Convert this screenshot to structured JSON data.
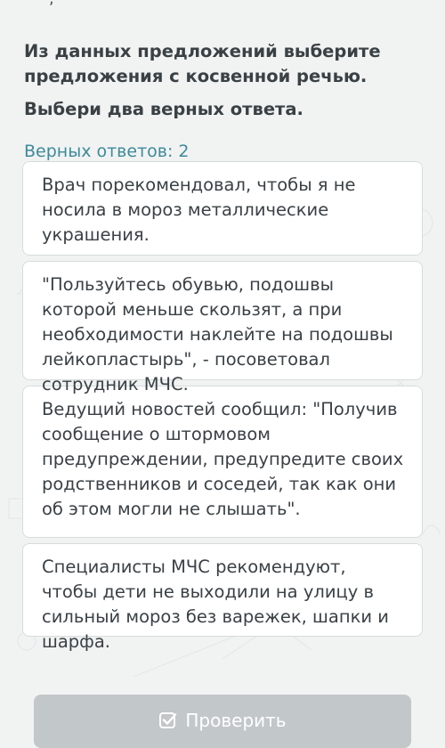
{
  "question": {
    "text": "Из данных предложений выберите предложения с косвенной речью.",
    "instruction": "Выбери два верных ответа.",
    "correct_answers_label": "Верных ответов: 2"
  },
  "options": [
    {
      "text": "Врач порекомендовал, чтобы я не носила в мороз металлические украшения."
    },
    {
      "text": "\"Пользуйтесь обувью, подошвы которой меньше скользят, а при необходимости наклейте на подошвы лейкопластырь\", - посоветовал сотрудник МЧС."
    },
    {
      "text": "Ведущий новостей сообщил: \"Получив сообщение о штормовом предупреждении, предупредите своих родственников и соседей, так как они об этом могли не слышать\"."
    },
    {
      "text": "Специалисты МЧС рекомендуют, чтобы дети не выходили на улицу в сильный мороз без варежек, шапки и шарфа."
    }
  ],
  "check_button": {
    "label": "Проверить",
    "icon": "check-square-icon",
    "state": "disabled"
  },
  "colors": {
    "background": "#f1f3f2",
    "accent": "#3d8a9a",
    "button_disabled": "#c2c7c9",
    "card_border": "#d6dcdb"
  }
}
